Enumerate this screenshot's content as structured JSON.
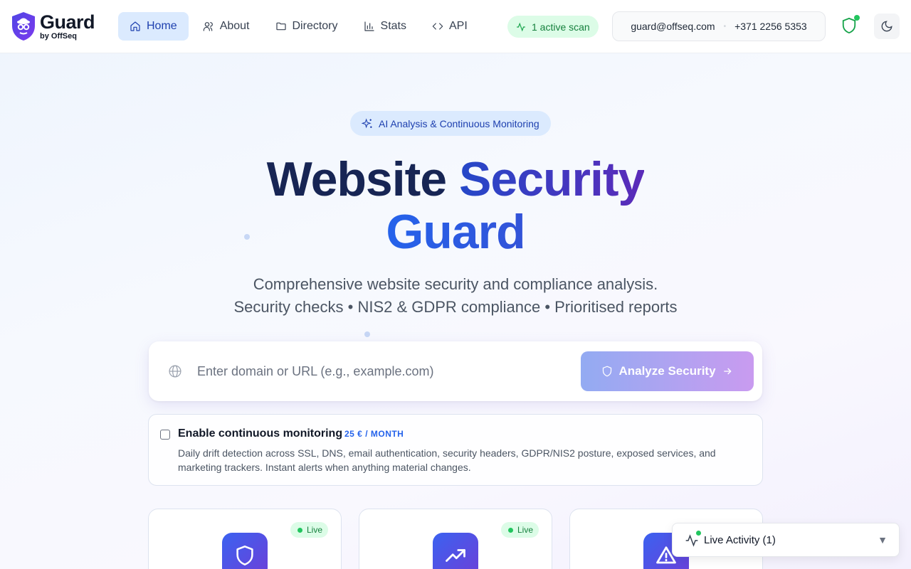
{
  "brand": {
    "name": "Guard",
    "sub": "by OffSeq",
    "logo_icon": "shield-spy-icon"
  },
  "nav": [
    {
      "label": "Home",
      "icon": "home-icon",
      "active": true
    },
    {
      "label": "About",
      "icon": "users-icon"
    },
    {
      "label": "Directory",
      "icon": "folder-icon"
    },
    {
      "label": "Stats",
      "icon": "bar-chart-icon"
    },
    {
      "label": "API",
      "icon": "code-icon"
    }
  ],
  "header": {
    "scan_status": "1 active scan",
    "email": "guard@offseq.com",
    "phone": "+371 2256 5353"
  },
  "hero": {
    "badge": "AI Analysis & Continuous Monitoring",
    "title_part1": "Website",
    "title_part2": "Security",
    "title_part3": "Guard",
    "subtitle_line1": "Comprehensive website security and compliance analysis.",
    "subtitle_line2": "Security checks • NIS2 & GDPR compliance • Prioritised reports"
  },
  "search": {
    "placeholder": "Enter domain or URL (e.g., example.com)",
    "value": "",
    "button_label": "Analyze Security"
  },
  "monitoring": {
    "title": "Enable continuous monitoring",
    "price": "25 € / MONTH",
    "checked": false,
    "description": "Daily drift detection across SSL, DNS, email authentication, security headers, GDPR/NIS2 posture, exposed services, and marketing trackers. Instant alerts when anything material changes."
  },
  "features": [
    {
      "icon": "shield-icon",
      "live_label": "Live"
    },
    {
      "icon": "trending-up-icon",
      "live_label": "Live"
    },
    {
      "icon": "alert-triangle-icon",
      "live_label": ""
    }
  ],
  "live_activity": {
    "label": "Live Activity (1)",
    "toggle": "▼"
  },
  "colors": {
    "accent": "#2563eb",
    "success": "#16a34a",
    "title_dark": "#172554",
    "gradient_violet": "#5b2bb9"
  }
}
